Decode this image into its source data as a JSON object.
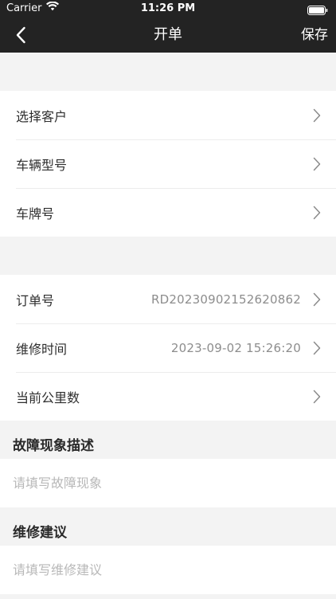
{
  "status_bar": {
    "carrier": "Carrier",
    "time": "11:26 PM"
  },
  "nav": {
    "title": "开单",
    "save_label": "保存",
    "back_icon": "chevron-left-icon"
  },
  "customer_group": {
    "rows": [
      {
        "label": "选择客户",
        "value": ""
      },
      {
        "label": "车辆型号",
        "value": ""
      },
      {
        "label": "车牌号",
        "value": ""
      }
    ]
  },
  "order_group": {
    "rows": [
      {
        "label": "订单号",
        "value": "RD20230902152620862"
      },
      {
        "label": "维修时间",
        "value": "2023-09-02 15:26:20"
      },
      {
        "label": "当前公里数",
        "value": ""
      }
    ]
  },
  "fault": {
    "title": "故障现象描述",
    "placeholder": "请填写故障现象",
    "value": ""
  },
  "advice": {
    "title": "维修建议",
    "placeholder": "请填写维修建议",
    "value": ""
  },
  "colors": {
    "nav_background": "#232323",
    "page_background": "#f3f3f3",
    "value_text": "#8d8d8d",
    "placeholder_text": "#b8b8b8"
  }
}
